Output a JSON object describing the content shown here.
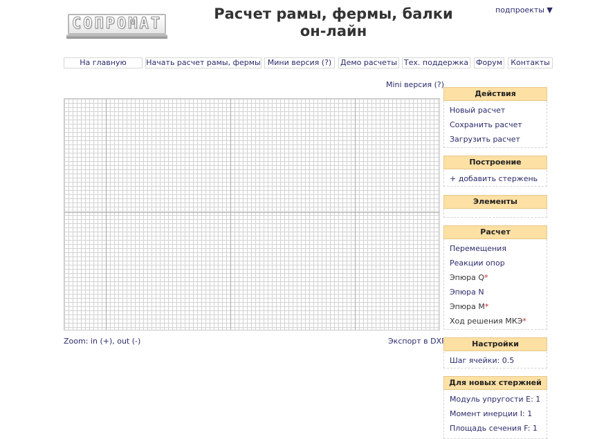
{
  "header": {
    "logo_text": "СОПРОМАТ",
    "title_line1": "Расчет рамы, фермы, балки",
    "title_line2": "он-лайн",
    "subprojects_label": "подпроекты ▼"
  },
  "nav": [
    {
      "label": "На главную"
    },
    {
      "label": "Начать расчет рамы, фермы"
    },
    {
      "label": "Мини версия (?)"
    },
    {
      "label": "Демо расчеты"
    },
    {
      "label": "Тех. поддержка"
    },
    {
      "label": "Форум"
    },
    {
      "label": "Контакты"
    }
  ],
  "mini_version_link": "Mini версия (?)",
  "canvas": {
    "zoom_text": "Zoom: in (+), out (-)",
    "export_label": "Экспорт в DXF"
  },
  "panels": {
    "actions": {
      "title": "Действия",
      "items": [
        "Новый расчет",
        "Сохранить расчет",
        "Загрузить расчет"
      ]
    },
    "build": {
      "title": "Построение",
      "items": [
        "+ добавить стержень"
      ]
    },
    "elements": {
      "title": "Элементы"
    },
    "calc": {
      "title": "Расчет",
      "items": [
        "Перемещения",
        "Реакции опор",
        "Эпюра Q",
        "Эпюра N",
        "Эпюра M",
        "Ход решения МКЭ"
      ],
      "star": "*"
    },
    "settings": {
      "title": "Настройки",
      "items": [
        "Шаг ячейки: 0.5"
      ]
    },
    "new_rods": {
      "title": "Для новых стержней",
      "items": [
        "Модуль упругости E: 1",
        "Момент инерции I: 1",
        "Площадь сечения F: 1"
      ]
    }
  },
  "colors": {
    "panel_header_bg": "#fde0a4",
    "link": "#2b2b6b",
    "star": "#cc2222"
  }
}
